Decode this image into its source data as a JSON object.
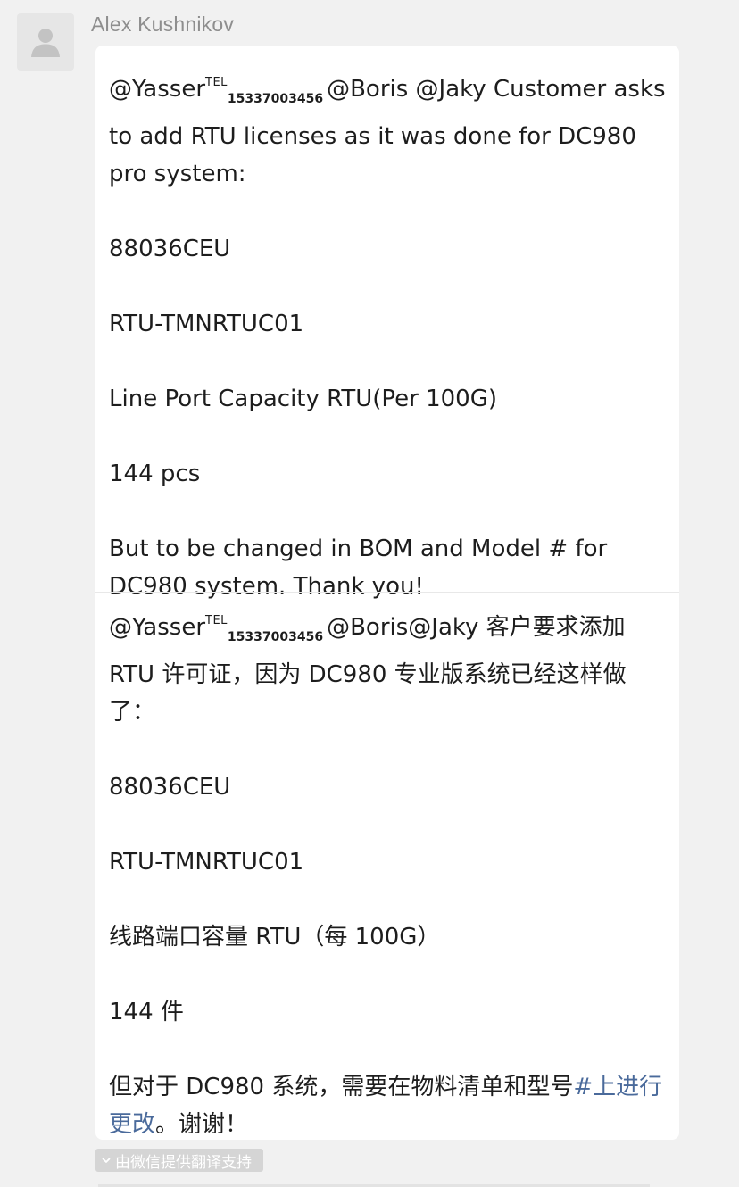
{
  "sender": {
    "name": "Alex Kushnikov"
  },
  "message": {
    "original": {
      "lead_mention": "@Yasser",
      "tel_badge": "TEL",
      "phone": "15337003456",
      "lead_rest": "@Boris @Jaky   Customer asks to add RTU licenses as it was done for DC980 pro system:",
      "code": "88036CEU",
      "part": "RTU-TMNRTUC01",
      "desc": "Line Port Capacity RTU(Per 100G)",
      "qty": "144 pcs",
      "closing": "But to be changed in BOM and Model # for DC980 system. Thank you!"
    },
    "translation": {
      "lead_mention": "@Yasser",
      "tel_badge": "TEL",
      "phone": "15337003456",
      "lead_rest": "@Boris@Jaky   客户要求添加 RTU 许可证，因为 DC980 专业版系统已经这样做了：",
      "code": "88036CEU",
      "part": "RTU-TMNRTUC01",
      "desc": "线路端口容量 RTU（每 100G）",
      "qty": "144 件",
      "closing_before": "但对于 DC980 系统，需要在物料清单和型号",
      "closing_link": "#上进行更改",
      "closing_after": "。谢谢！"
    }
  },
  "translate_tag": {
    "label": "由微信提供翻译支持"
  },
  "icons": {
    "avatar": "default-user-silhouette",
    "translate_toggle": "chevron-down-icon"
  },
  "colors": {
    "background": "#f1f1f1",
    "bubble": "#ffffff",
    "link": "#4a6a9b",
    "sender": "#8e8e8e",
    "tag": "#d5d5d5"
  }
}
